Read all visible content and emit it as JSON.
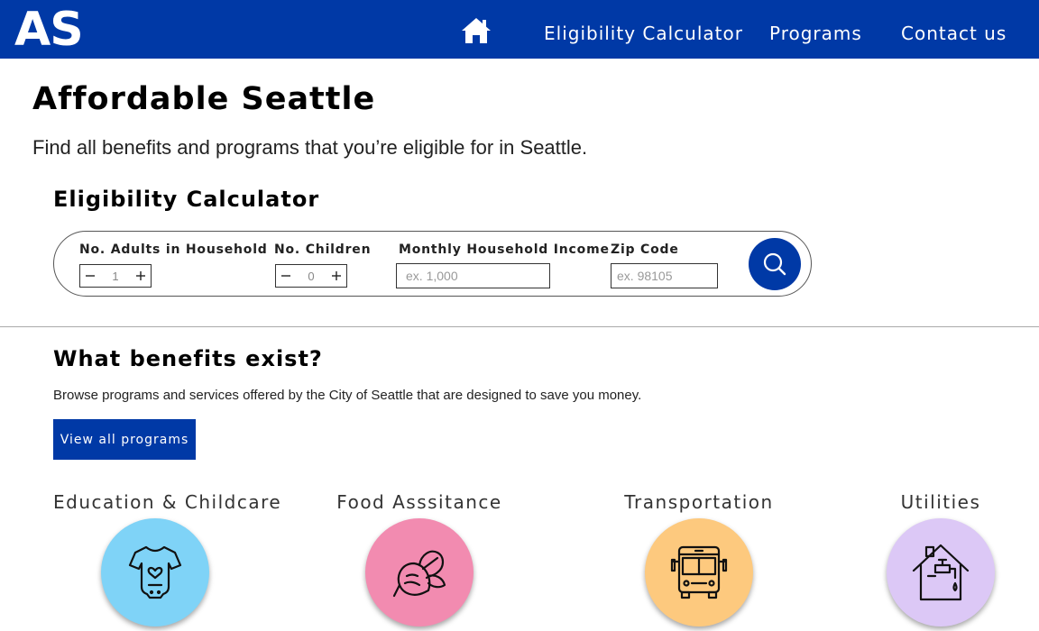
{
  "nav": {
    "logo": "AS",
    "home_icon": "home-icon",
    "links": [
      "Eligibility Calculator",
      "Programs",
      "Contact us"
    ]
  },
  "header": {
    "title": "Affordable Seattle",
    "subtitle": "Find all benefits and programs that you’re eligible for in Seattle."
  },
  "calculator": {
    "heading": "Eligibility Calculator",
    "adults": {
      "label": "No. Adults in Household",
      "value": "1"
    },
    "children": {
      "label": "No. Children",
      "value": "0"
    },
    "income": {
      "label": "Monthly Household Income",
      "placeholder": "ex. 1,000"
    },
    "zip": {
      "label": "Zip Code",
      "placeholder": "ex. 98105"
    },
    "search_icon": "search-icon"
  },
  "benefits": {
    "heading": "What benefits exist?",
    "description": "Browse programs and services offered by the City of Seattle that are designed to save you money.",
    "button_label": "View all programs",
    "categories": [
      {
        "title": "Education & Childcare",
        "icon": "onesie-icon",
        "color": "#7fd3f7"
      },
      {
        "title": "Food Asssitance",
        "icon": "beet-icon",
        "color": "#f28bb0"
      },
      {
        "title": "Transportation",
        "icon": "bus-icon",
        "color": "#fdc97e"
      },
      {
        "title": "Utilities",
        "icon": "house-faucet-icon",
        "color": "#dcc8f6"
      }
    ]
  },
  "colors": {
    "brand": "#0039a6",
    "text": "#000000"
  }
}
